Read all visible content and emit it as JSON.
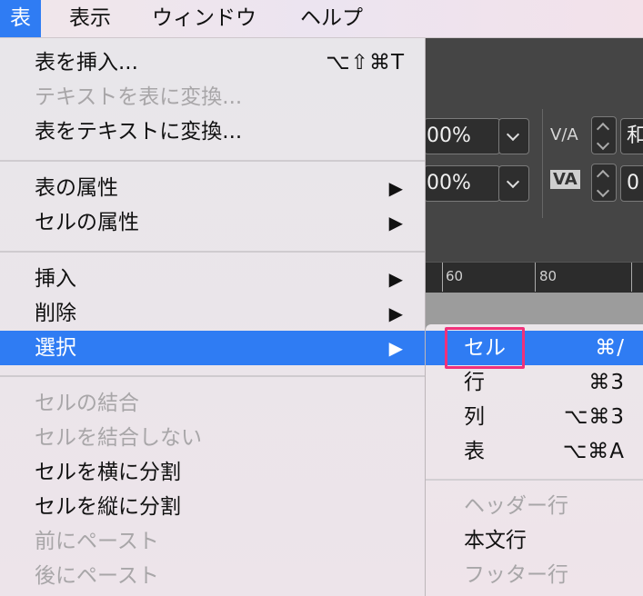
{
  "menubar": {
    "items": [
      {
        "label": "表",
        "active": true
      },
      {
        "label": "表示"
      },
      {
        "label": "ウィンドウ"
      },
      {
        "label": "ヘルプ"
      }
    ]
  },
  "app_bg": {
    "field1_value": "00%",
    "field2_value": "00%",
    "field3_value": "和",
    "field4_value": "0",
    "kerning_icon": "V/A",
    "tracking_icon": "VA",
    "ruler": {
      "ticks": [
        "60",
        "80"
      ]
    }
  },
  "menu": {
    "items": [
      {
        "label": "表を挿入...",
        "shortcut": "⌥⇧⌘T",
        "disabled": false
      },
      {
        "label": "テキストを表に変換...",
        "disabled": true
      },
      {
        "label": "表をテキストに変換...",
        "disabled": false
      },
      {
        "label": "表の属性",
        "submenu": "▶"
      },
      {
        "label": "セルの属性",
        "submenu": "▶"
      },
      {
        "label": "挿入",
        "submenu": "▶"
      },
      {
        "label": "削除",
        "submenu": "▶"
      },
      {
        "label": "選択",
        "submenu": "▶",
        "selected": true
      },
      {
        "label": "セルの結合",
        "disabled": true
      },
      {
        "label": "セルを結合しない",
        "disabled": true
      },
      {
        "label": "セルを横に分割",
        "disabled": false
      },
      {
        "label": "セルを縦に分割",
        "disabled": false
      },
      {
        "label": "前にペースト",
        "disabled": true
      },
      {
        "label": "後にペースト",
        "disabled": true
      }
    ]
  },
  "submenu": {
    "items": [
      {
        "label": "セル",
        "shortcut": "⌘/",
        "selected": true
      },
      {
        "label": "行",
        "shortcut": "⌘3"
      },
      {
        "label": "列",
        "shortcut": "⌥⌘3"
      },
      {
        "label": "表",
        "shortcut": "⌥⌘A"
      },
      {
        "label": "ヘッダー行",
        "disabled": true
      },
      {
        "label": "本文行"
      },
      {
        "label": "フッター行",
        "disabled": true
      }
    ]
  },
  "colors": {
    "accent": "#2f7cf3",
    "highlight_box": "#f0317a"
  }
}
